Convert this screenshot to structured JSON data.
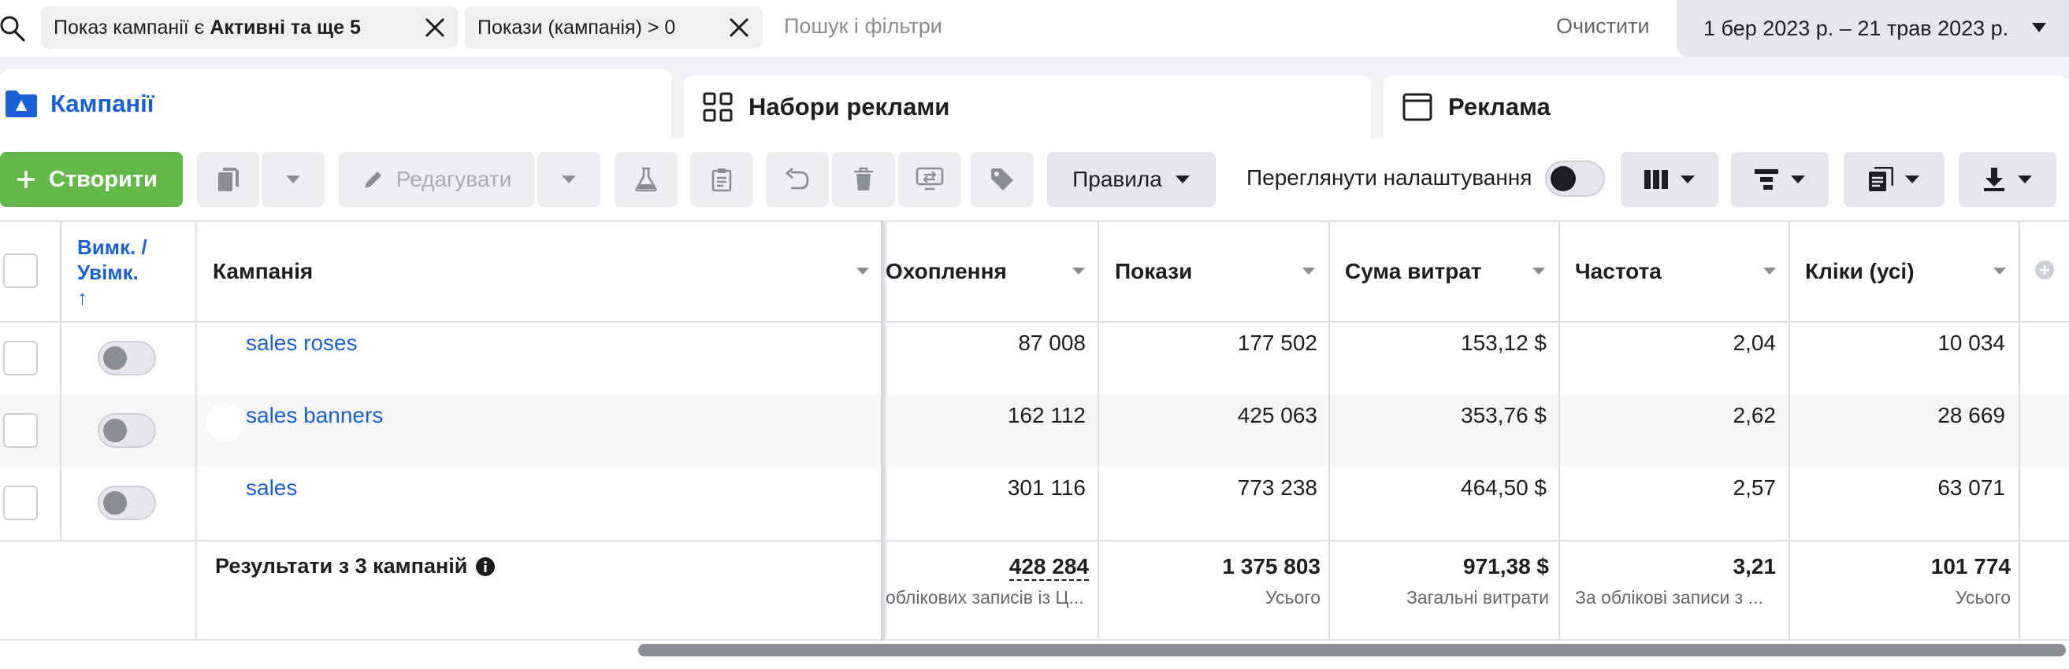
{
  "filters": {
    "chip1_text": "Показ кампанії є ",
    "chip1_bold": "Активні та ще 5",
    "chip2_text": "Покази (кампанія) > 0",
    "search_placeholder": "Пошук і фільтри",
    "clear_label": "Очистити",
    "date_range": "1 бер 2023 р. – 21 трав 2023 р."
  },
  "tabs": [
    {
      "label": "Кампанії",
      "active": true
    },
    {
      "label": "Набори реклами",
      "active": false
    },
    {
      "label": "Реклама",
      "active": false
    }
  ],
  "toolbar": {
    "create_label": "Створити",
    "edit_label": "Редагувати",
    "rules_label": "Правила",
    "review_settings_label": "Переглянути налаштування"
  },
  "table": {
    "headers": {
      "toggle_col": "Вимк. / Увімк.",
      "toggle_sort": "↑",
      "campaign": "Кампанія",
      "reach": "Охоплення",
      "impressions": "Покази",
      "spend": "Сума витрат",
      "frequency": "Частота",
      "clicks": "Кліки (усі)"
    },
    "rows": [
      {
        "name": "sales roses",
        "reach": "87 008",
        "impressions": "177 502",
        "spend": "153,12 $",
        "frequency": "2,04",
        "clicks": "10 034"
      },
      {
        "name": "sales banners",
        "reach": "162 112",
        "impressions": "425 063",
        "spend": "353,76 $",
        "frequency": "2,62",
        "clicks": "28 669"
      },
      {
        "name": "sales",
        "reach": "301 116",
        "impressions": "773 238",
        "spend": "464,50 $",
        "frequency": "2,57",
        "clicks": "63 071"
      }
    ],
    "totals": {
      "label": "Результати з 3 кампаній",
      "reach": "428 284",
      "reach_sub": "облікових записів із Ц...",
      "impressions": "1 375 803",
      "impressions_sub": "Усього",
      "spend": "971,38 $",
      "spend_sub": "Загальні витрати",
      "frequency": "3,21",
      "frequency_sub": "За облікові записи з ...",
      "clicks": "101 774",
      "clicks_sub": "Усього"
    }
  },
  "colors": {
    "accent": "#1b5fd6",
    "create_green": "#63b84a",
    "row_alt": "#f5f6f7"
  }
}
